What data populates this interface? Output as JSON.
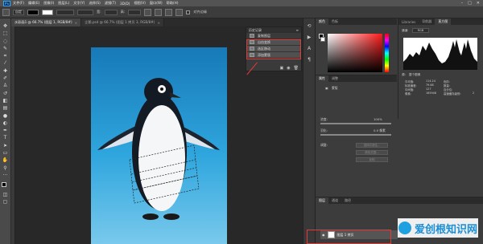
{
  "menu": {
    "items": [
      "文件(F)",
      "编辑(E)",
      "图像(I)",
      "图层(L)",
      "文字(Y)",
      "选择(S)",
      "滤镜(T)",
      "3D(D)",
      "视图(V)",
      "窗口(W)",
      "帮助(H)"
    ]
  },
  "options": {
    "preset": "自定",
    "width_label": "宽:",
    "height_label": "高:",
    "anti_alias_label": "消除锯齿",
    "follow_label": "对齐边缘"
  },
  "documents": {
    "tab1": "水彩画1 @ 66.7% (图层 1, RGB/8#)",
    "tab2": "企鹅.psd @ 66.7% (图层 1 拷贝 3, RGB/8#)"
  },
  "history": {
    "title": "历史记录",
    "items": [
      "复制图层",
      "自由变换",
      "选区移动",
      "添加蒙版"
    ]
  },
  "color_panel": {
    "tab_color": "颜色",
    "tab_swatch": "色板"
  },
  "histogram": {
    "tabs": [
      "Libraries",
      "导航器",
      "直方图"
    ],
    "channel_label": "通道:",
    "channel_value": "RGB",
    "source_label": "源:",
    "source_value": "整个图像",
    "stats": {
      "mean_label": "平均值:",
      "mean": "114.24",
      "stddev_label": "标准偏差:",
      "stddev": "79.68",
      "median_label": "中间值:",
      "median": "127",
      "pixels_label": "像素:",
      "pixels": "165948",
      "level_label": "色阶:",
      "count_label": "数量:",
      "percentile_label": "百分位:",
      "cache_label": "高速缓存级别:",
      "cache": "2"
    }
  },
  "properties": {
    "tabs": [
      "属性",
      "调整"
    ],
    "mask_label": "蒙版",
    "density_label": "浓度:",
    "density_value": "100%",
    "feather_label": "羽化:",
    "feather_value": "0.0 像素",
    "refine_label": "调整:",
    "btn_edge": "选择并遮住...",
    "btn_color": "颜色范围...",
    "btn_invert": "反相"
  },
  "layers": {
    "tabs": [
      "图层",
      "通道",
      "路径"
    ],
    "layer_name": "图层 1 拷贝"
  },
  "watermark": {
    "text": "爱创根知识网"
  }
}
